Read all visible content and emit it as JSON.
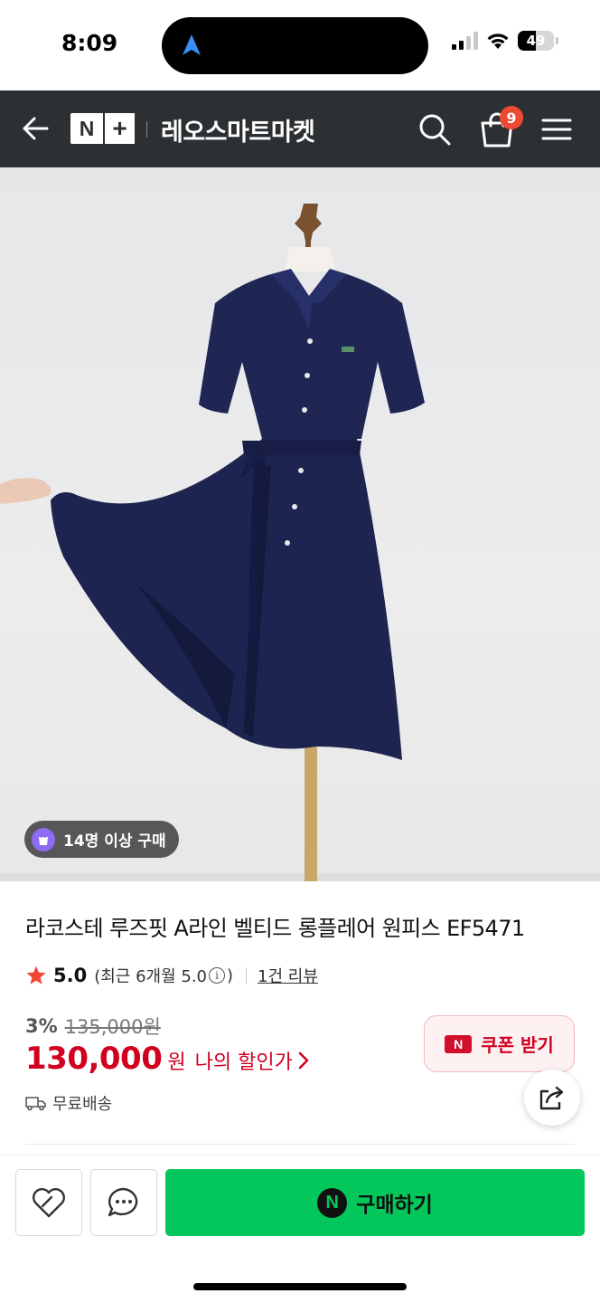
{
  "status_bar": {
    "time": "8:09",
    "battery": "49",
    "battery_level_pct": 49
  },
  "header": {
    "logo_n": "N",
    "logo_plus": "+",
    "store_name": "레오스마트마켓",
    "cart_count": "9"
  },
  "product": {
    "buyers_badge": "14명 이상 구매",
    "title": "라코스테 루즈핏 A라인 벨티드 롱플레어 원피스 EF5471",
    "rating": "5.0",
    "rating_recent_prefix": "(최근 6개월 5.0",
    "rating_recent_suffix": ")",
    "review_count": "1건 리뷰",
    "discount_rate": "3%",
    "original_price": "135,000원",
    "sale_price": "130,000",
    "currency": "원",
    "my_discount": "나의 할인가",
    "shipping": "무료배송"
  },
  "coupon": {
    "badge": "N",
    "label": "쿠폰 받기"
  },
  "bottom": {
    "buy_badge": "N",
    "buy_label": "구매하기"
  },
  "colors": {
    "header_bg": "#2d3033",
    "price_red": "#d1001f",
    "buy_green": "#03c75a",
    "badge_red": "#f04933",
    "buyer_badge_purple": "#8e6cf1"
  },
  "icons": {
    "back": "arrow-left-icon",
    "search": "search-icon",
    "cart": "shopping-bag-icon",
    "menu": "hamburger-menu-icon",
    "star": "star-icon",
    "info": "info-icon",
    "shipping": "truck-icon",
    "share": "share-icon",
    "wish": "heart-icon",
    "talk": "chat-icon"
  }
}
